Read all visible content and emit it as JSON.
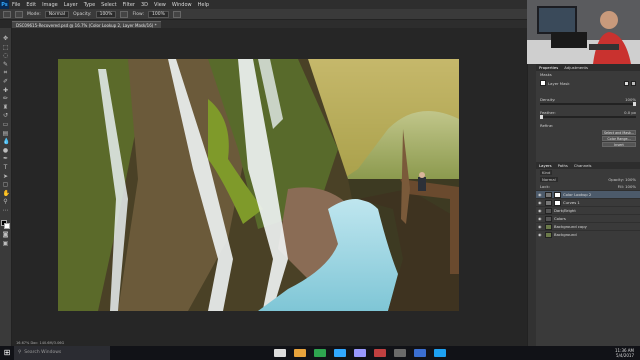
{
  "app": {
    "logo": "Ps"
  },
  "menu": [
    "File",
    "Edit",
    "Image",
    "Layer",
    "Type",
    "Select",
    "Filter",
    "3D",
    "View",
    "Window",
    "Help"
  ],
  "options": {
    "mode_label": "Mode:",
    "mode_value": "Normal",
    "opacity_label": "Opacity:",
    "opacity_value": "100%",
    "flow_label": "Flow:",
    "flow_value": "100%"
  },
  "document_tab": "DSC09615-Recovered.psd @ 16.7% (Color Lookup 2, Layer Mask/16) *",
  "status": "16.67%   Doc: 140.6M/3.06G",
  "properties": {
    "tabs": [
      "Properties",
      "Adjustments"
    ],
    "section": "Masks",
    "mask_label": "Layer Mask",
    "density_label": "Density:",
    "density_value": "100%",
    "feather_label": "Feather:",
    "feather_value": "0.0 px",
    "refine_label": "Refine:",
    "buttons": [
      "Select and Mask...",
      "Color Range...",
      "Invert"
    ]
  },
  "layers": {
    "tabs": [
      "Layers",
      "Paths",
      "Channels"
    ],
    "kind": "Kind",
    "blend": "Normal",
    "opacity_label": "Opacity:",
    "opacity_value": "100%",
    "lock_label": "Lock:",
    "fill_label": "Fill:",
    "fill_value": "100%",
    "items": [
      "Color Lookup 2",
      "Curves 1",
      "Dark/Bright",
      "Colors",
      "Background copy",
      "Background"
    ]
  },
  "taskbar": {
    "search_placeholder": "Search Windows",
    "time": "11:36 AM",
    "date": "5/4/2017"
  },
  "colors": {
    "accent": "#31a8ff",
    "selected_layer": "#4c5a6a"
  }
}
